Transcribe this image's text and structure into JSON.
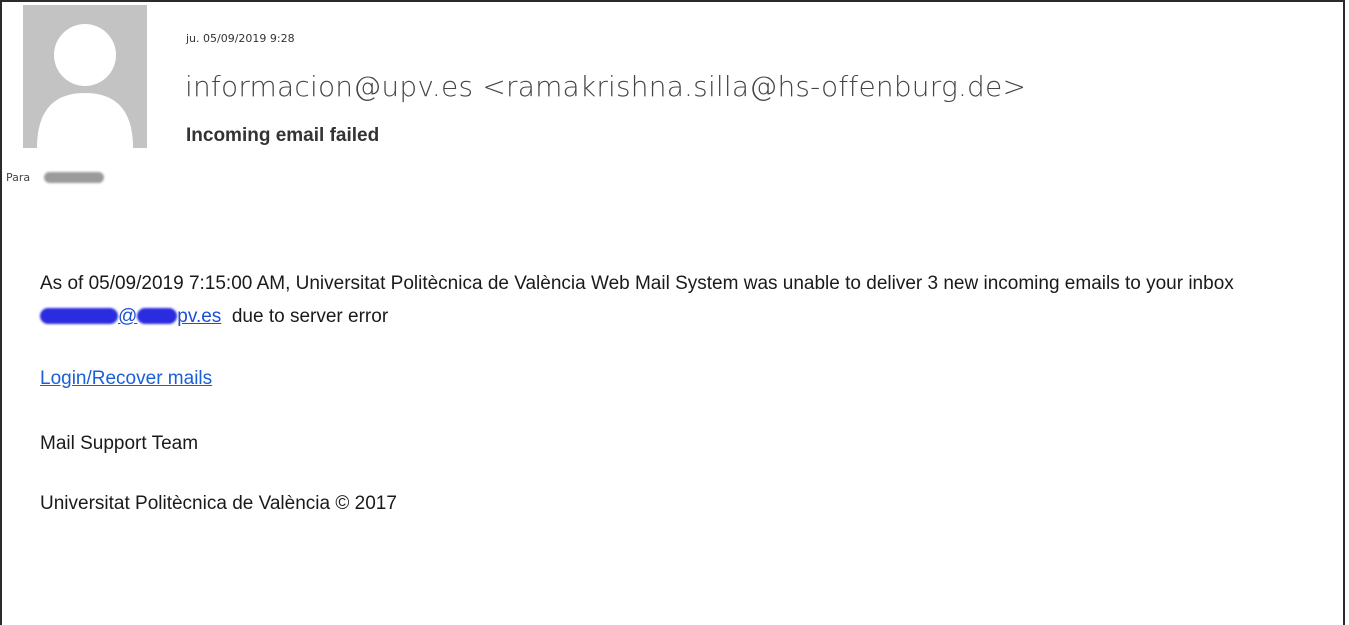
{
  "header": {
    "date": "ju. 05/09/2019 9:28",
    "sender": "informacion@upv.es <ramakrishna.silla@hs-offenburg.de>",
    "subject": "Incoming email failed",
    "to_label": "Para"
  },
  "body": {
    "text_before_link": "As of 05/09/2019 7:15:00 AM, Universitat Politècnica de València Web Mail System was unable to deliver 3 new incoming emails to your inbox ",
    "inbox_link_visible": "@",
    "inbox_link_suffix": "pv.es",
    "text_after_link": "  due to server error",
    "recover_link": "Login/Recover mails",
    "signature_team": "Mail Support Team",
    "signature_footer": "Universitat Politècnica de València © 2017"
  },
  "colors": {
    "link": "#1a5fd8",
    "redaction_blue": "#2b2be0",
    "avatar_bg": "#c3c3c3"
  },
  "icons": {
    "avatar": "person-silhouette-icon"
  }
}
